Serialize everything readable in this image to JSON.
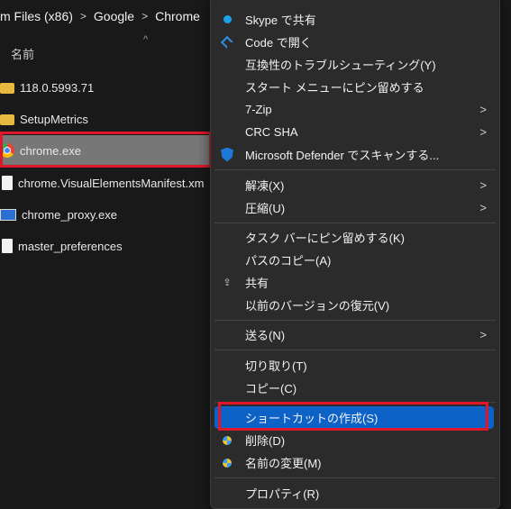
{
  "breadcrumb": {
    "items": [
      "m Files (x86)",
      "Google",
      "Chrome"
    ],
    "separator": ">"
  },
  "columns": {
    "name_header": "名前",
    "sort_icon": "^"
  },
  "files": [
    {
      "name": "118.0.5993.71",
      "icon": "folder-icon"
    },
    {
      "name": "SetupMetrics",
      "icon": "folder-icon"
    },
    {
      "name": "chrome.exe",
      "icon": "chrome-icon",
      "selected": true
    },
    {
      "name": "chrome.VisualElementsManifest.xm",
      "icon": "document-icon"
    },
    {
      "name": "chrome_proxy.exe",
      "icon": "exe-icon"
    },
    {
      "name": "master_preferences",
      "icon": "document-icon"
    }
  ],
  "context_menu": {
    "skype": "Skype で共有",
    "code": "Code で開く",
    "compat": "互換性のトラブルシューティング(Y)",
    "pin_start": "スタート メニューにピン留めする",
    "zip": "7-Zip",
    "crc": "CRC SHA",
    "defender": "Microsoft Defender でスキャンする...",
    "extract": "解凍(X)",
    "compress": "圧縮(U)",
    "pin_taskbar": "タスク バーにピン留めする(K)",
    "copy_path": "パスのコピー(A)",
    "share": "共有",
    "restore": "以前のバージョンの復元(V)",
    "send_to": "送る(N)",
    "cut": "切り取り(T)",
    "copy": "コピー(C)",
    "create_shortcut": "ショートカットの作成(S)",
    "delete": "削除(D)",
    "rename": "名前の変更(M)",
    "properties": "プロパティ(R)",
    "submenu_arrow": ">"
  },
  "colors": {
    "accent": "#0d62c8",
    "highlight": "#e0172a",
    "selected_row": "#777777"
  }
}
